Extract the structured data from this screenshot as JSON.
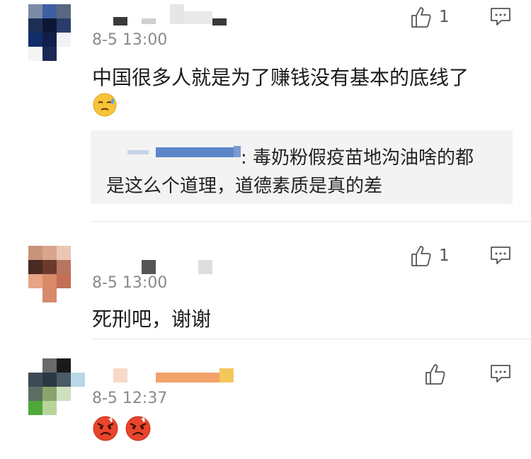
{
  "comments": [
    {
      "time": "8-5 13:00",
      "text": "中国很多人就是为了赚钱没有基本的底线了",
      "like_count": "1",
      "quote": {
        "line1": ": 毒奶粉假疫苗地沟油啥的都",
        "line2": "是这么个道理，道德素质是真的差"
      },
      "emoji": "sweat-emoji"
    },
    {
      "time": "8-5 13:00",
      "text": "死刑吧，谢谢",
      "like_count": "1"
    },
    {
      "time": "8-5 12:37",
      "text": "",
      "like_count": "",
      "emojis": [
        "angry-emoji",
        "angry-emoji"
      ]
    }
  ],
  "icons": {
    "like": "thumbs-up-icon",
    "reply": "comment-icon"
  },
  "colors": {
    "time": "#8a8a8a",
    "quote_bg": "#f3f3f3",
    "divider": "#e6e6e6",
    "angry": "#e8452c"
  }
}
